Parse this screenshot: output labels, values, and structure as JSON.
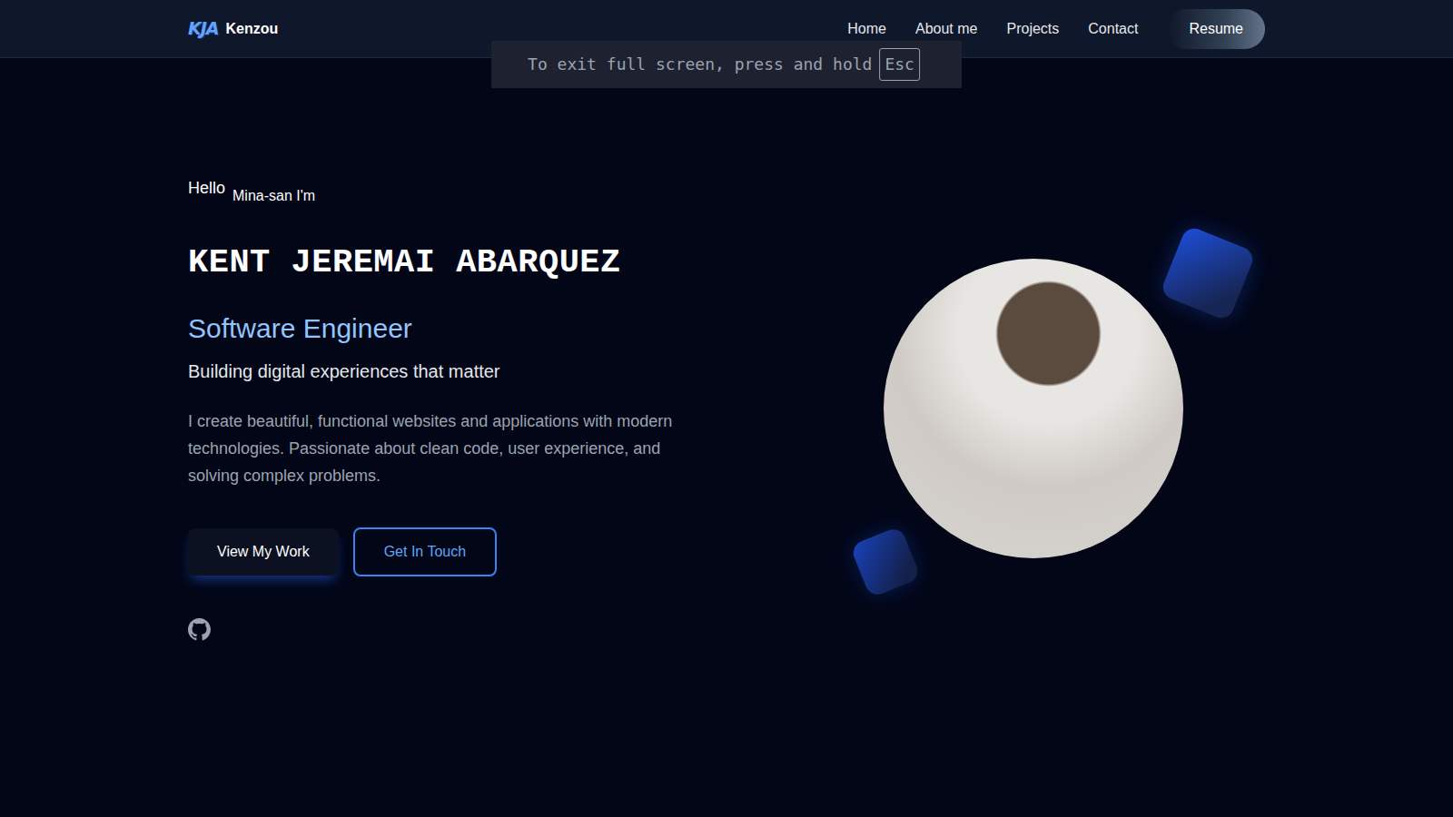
{
  "fullscreen_notice": {
    "text": "To exit full screen, press and hold",
    "key": "Esc"
  },
  "brand": {
    "logo": "KJA",
    "name": "Kenzou"
  },
  "nav": {
    "items": [
      "Home",
      "About me",
      "Projects",
      "Contact"
    ],
    "resume": "Resume"
  },
  "hero": {
    "greeting": "Hello",
    "greeting_sub": "Mina-san I'm",
    "name": "KENT JEREMAI ABARQUEZ",
    "role": "Software Engineer",
    "tagline": "Building digital experiences that matter",
    "description": "I create beautiful, functional websites and applications with modern technologies. Passionate about clean code, user experience, and solving complex problems.",
    "buttons": [
      "View My Work",
      "Get In Touch"
    ]
  }
}
